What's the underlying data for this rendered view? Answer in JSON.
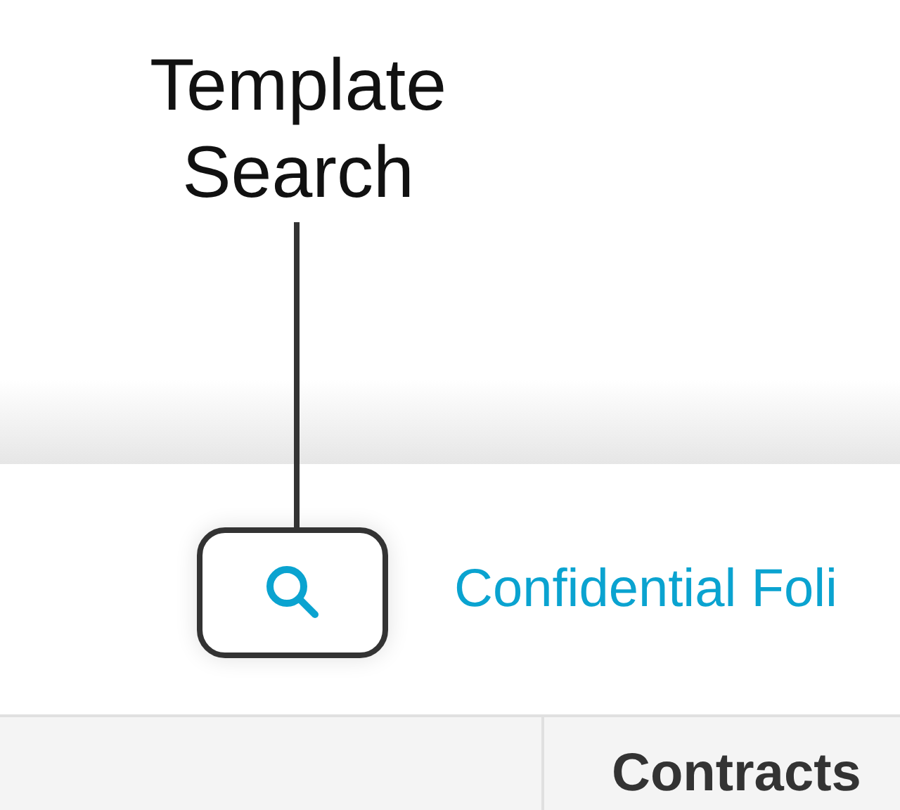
{
  "callout": {
    "title": "Template Search"
  },
  "toolbar": {
    "link": "Confidential Foli"
  },
  "table": {
    "columns": [
      {
        "label": "Contracts"
      }
    ]
  }
}
